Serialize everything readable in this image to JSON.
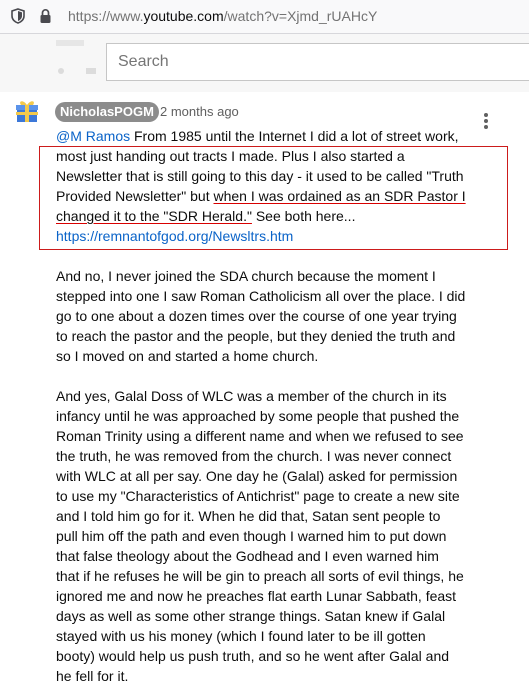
{
  "browser": {
    "url_prefix": "https://www.",
    "url_host": "youtube.com",
    "url_path": "/watch?v=Xjmd_rUAHcY"
  },
  "search": {
    "placeholder": "Search"
  },
  "comment": {
    "author": "NicholasPOGM",
    "time": "2 months ago",
    "mention": "@M Ramos",
    "p1_intro": " From 1985 until the Internet I did a lot of street work, most just handing out tracts I made. Plus I also started a Newsletter that is still going to this day - it used to be called \"Truth Provided Newsletter\" but ",
    "p1_underlined": "when I was ordained as an SDR Pastor I changed it to the \"SDR Herald.\"",
    "p1_tail": " See both here...",
    "link": "https://remnantofgod.org/Newsltrs.htm",
    "p2": "And no, I never joined the SDA church because the moment I stepped into one I saw Roman Catholicism all over the place. I did go to one about a dozen times over the course of one year trying to reach the pastor and the people, but they denied the truth and so I moved on and started a home church.",
    "p3": "And yes, Galal Doss of WLC was a member of the church in its infancy until he was approached by some people that pushed the Roman Trinity using a different name and when we refused to see the truth, he was removed from the church. I was never connect with WLC at all per say. One day he (Galal) asked for permission to use my \"Characteristics of Antichrist\" page to create a new site and I told him go for it. When he did that, Satan sent people to pull him off the path and even though I warned him to put down that false theology about the Godhead and I even warned him that if he refuses he will be gin to preach all sorts of evil things, he ignored me and now he preaches flat earth Lunar Sabbath, feast days as well as some other strange things. Satan knew if Galal stayed with us his money (which I found later to be ill gotten booty) would help us push truth, and so he went after Galal and he fell for it."
  },
  "colors": {
    "link": "#0a63c8",
    "highlight_box": "#cc1b1b",
    "author_badge": "#8c8c8c"
  },
  "icons": [
    "shield-icon",
    "lock-icon",
    "gift-avatar-icon",
    "more-vert-icon"
  ]
}
